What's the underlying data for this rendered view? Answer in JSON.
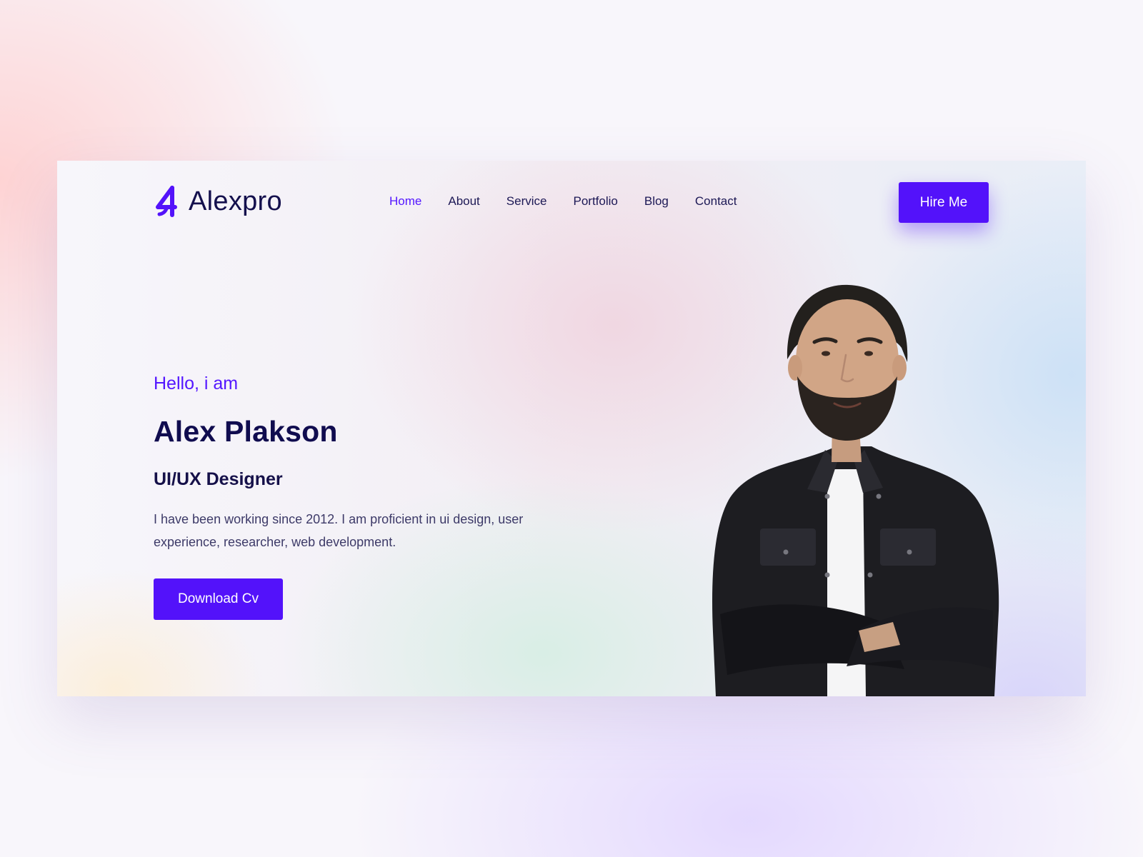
{
  "brand": {
    "name": "Alexpro",
    "logo_icon": "letter-a-4-logo-icon",
    "accent_color": "#5312fa"
  },
  "nav": {
    "items": [
      {
        "label": "Home",
        "active": true
      },
      {
        "label": "About",
        "active": false
      },
      {
        "label": "Service",
        "active": false
      },
      {
        "label": "Portfolio",
        "active": false
      },
      {
        "label": "Blog",
        "active": false
      },
      {
        "label": "Contact",
        "active": false
      }
    ]
  },
  "header": {
    "hire_label": "Hire Me"
  },
  "hero": {
    "greeting": "Hello, i am",
    "name": "Alex Plakson",
    "role": "UI/UX Designer",
    "bio": "I have been working since 2012. I am proficient in ui design, user experience, researcher, web development.",
    "cta_label": "Download Cv",
    "portrait": "bearded-man-black-denim-jacket-arms-crossed"
  },
  "colors": {
    "heading": "#100c4f",
    "body_text": "#3d3a68",
    "nav_active": "#5417ff"
  }
}
